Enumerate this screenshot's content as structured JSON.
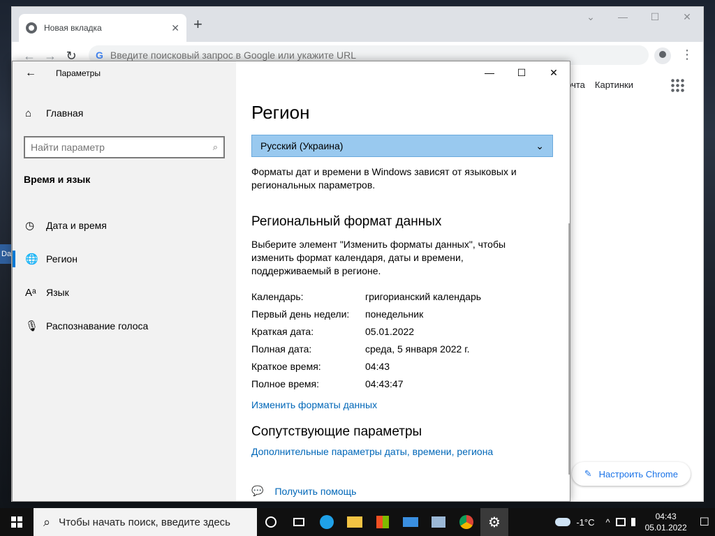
{
  "desktop": {
    "stub_label": "Da"
  },
  "chrome": {
    "tab_title": "Новая вкладка",
    "tab_close": "✕",
    "new_tab": "+",
    "window_controls": [
      "⌄",
      "—",
      "☐",
      "✕"
    ],
    "back": "←",
    "forward": "→",
    "reload": "↻",
    "g_logo": "G",
    "omnibox_placeholder": "Введите поисковый запрос в Google или укажите URL",
    "menu": "⋮",
    "links": {
      "mail": "Почта",
      "images": "Картинки"
    },
    "customize_label": "Настроить Chrome",
    "customize_icon": "✎"
  },
  "settings": {
    "back": "←",
    "title": "Параметры",
    "home_icon": "⌂",
    "home_label": "Главная",
    "search_placeholder": "Найти параметр",
    "search_icon": "⌕",
    "section": "Время и язык",
    "nav": [
      {
        "icon": "◷",
        "label": "Дата и время"
      },
      {
        "icon": "🌐",
        "label": "Регион"
      },
      {
        "icon": "Aᵃ",
        "label": "Язык"
      },
      {
        "icon": "🎙",
        "label": "Распознавание голоса"
      }
    ],
    "window_controls": [
      "—",
      "☐",
      "✕"
    ],
    "page_title": "Регион",
    "region_value": "Русский (Украина)",
    "dropdown_chevron": "⌄",
    "region_desc": "Форматы дат и времени в Windows зависят от языковых и региональных параметров.",
    "format_heading": "Региональный формат данных",
    "format_desc": "Выберите элемент \"Изменить форматы данных\", чтобы изменить формат календаря, даты и времени, поддерживаемый в регионе.",
    "formats": [
      {
        "key": "Календарь:",
        "value": "григорианский календарь"
      },
      {
        "key": "Первый день недели:",
        "value": "понедельник"
      },
      {
        "key": "Краткая дата:",
        "value": "05.01.2022"
      },
      {
        "key": "Полная дата:",
        "value": "среда, 5 января 2022 г."
      },
      {
        "key": "Краткое время:",
        "value": "04:43"
      },
      {
        "key": "Полное время:",
        "value": "04:43:47"
      }
    ],
    "change_formats_link": "Изменить форматы данных",
    "related_heading": "Сопутствующие параметры",
    "related_link": "Дополнительные параметры даты, времени, региона",
    "help_icon": "💬",
    "help_link": "Получить помощь"
  },
  "taskbar": {
    "search_icon": "⌕",
    "search_placeholder": "Чтобы начать поиск, введите здесь",
    "weather": "-1°C",
    "tray_arrow": "^",
    "time": "04:43",
    "date": "05.01.2022",
    "notif_icon": "☐",
    "colors": {
      "edge": "#1fa1e8",
      "folder": "#f3c343",
      "mail": "#3a8fe0",
      "chrome_red": "#db4437"
    }
  }
}
